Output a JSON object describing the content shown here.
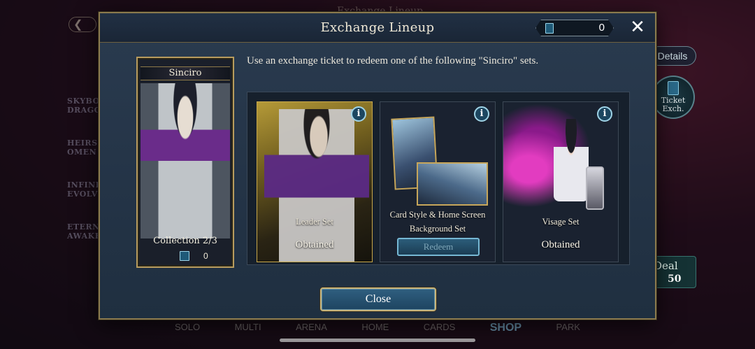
{
  "background": {
    "title": "Exchange Lineup",
    "back_arrow": "❮",
    "logos": [
      "SKYBOUND DRAGONS",
      "HEIRS OF OMEN",
      "INFINITY EVOLVED",
      "ETERNAL AWAKENING"
    ],
    "details_label": "Details",
    "ticket_exchange_label": "Ticket Exch.",
    "deal_label": "Deal",
    "deal_price": "50",
    "nav": [
      "SOLO",
      "MULTI",
      "ARENA",
      "HOME",
      "CARDS",
      "SHOP",
      "PARK"
    ]
  },
  "modal": {
    "title": "Exchange Lineup",
    "ticket_count": "0",
    "close_icon": "✕",
    "description": "Use an exchange ticket to redeem one of the following \"Sinciro\" sets.",
    "collection": {
      "name": "Sinciro",
      "label": "Collection  2/3",
      "ticket_count": "0"
    },
    "items": [
      {
        "label": "Leader Set",
        "status": "Obtained"
      },
      {
        "label_line1": "Card Style & Home Screen",
        "label_line2": "Background Set",
        "button": "Redeem"
      },
      {
        "label": "Visage Set",
        "status": "Obtained"
      }
    ],
    "info_icon": "i",
    "close_button": "Close"
  },
  "colors": {
    "accent_gold": "#c8b47a",
    "button_blue": "#1e4460",
    "panel": "#243447"
  }
}
